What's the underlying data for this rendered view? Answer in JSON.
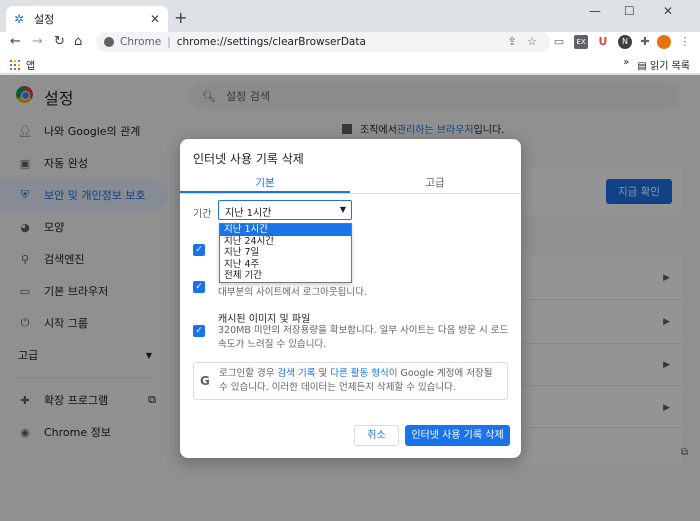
{
  "browser": {
    "tab_title": "설정",
    "tab_close": "✕",
    "new_tab": "+",
    "window_controls": [
      "—",
      "☐",
      "✕"
    ],
    "nav": {
      "back": "←",
      "forward": "→",
      "reload": "↻",
      "home": "⌂"
    },
    "url_host": "Chrome",
    "url_sep": "|",
    "url_path": "chrome://settings/clearBrowserData",
    "bookmarks": {
      "apps_label": "앱",
      "more": "»",
      "reading_list": "읽기 목록"
    },
    "colors": {
      "accent": "#1a73e8",
      "tabstrip": "#dee1e6"
    }
  },
  "settings": {
    "title": "설정",
    "search_placeholder": "설정 검색",
    "sidebar": [
      {
        "label": "나와 Google의 관계",
        "icon": "person-icon"
      },
      {
        "label": "자동 완성",
        "icon": "clipboard-icon"
      },
      {
        "label": "보안 및 개인정보 보호",
        "icon": "shield-icon",
        "active": true
      },
      {
        "label": "모양",
        "icon": "palette-icon"
      },
      {
        "label": "검색엔진",
        "icon": "search-icon"
      },
      {
        "label": "기본 브라우저",
        "icon": "browser-icon"
      },
      {
        "label": "시작 그룹",
        "icon": "power-icon"
      }
    ],
    "advanced": "고급",
    "extensions": "확장 프로그램",
    "about": "Chrome 정보",
    "managed_prefix": "조직에서 ",
    "managed_link": "관리하는 브라우저",
    "managed_suffix": "입니다.",
    "check_now": "지금 확인"
  },
  "dialog": {
    "title": "인터넷 사용 기록 삭제",
    "tabs": {
      "basic": "기본",
      "advanced": "고급"
    },
    "range_label": "기간",
    "range_selected": "지난 1시간",
    "range_options": [
      "지난 1시간",
      "지난 24시간",
      "지난 7일",
      "지난 4주",
      "전체 기간"
    ],
    "cookies_desc_partial": "대부분의 사이트에서 로그아웃됩니다.",
    "cache_title": "캐시된 이미지 및 파일",
    "cache_desc": "320MB 미만의 저장용량을 확보합니다. 일부 사이트는 다음 방문 시 로드 속도가 느려질 수 있습니다.",
    "info": {
      "part1": "로그인할 경우 ",
      "link1": "검색 기록",
      "part2": " 및 ",
      "link2": "다른 활동 형식",
      "part3": "이 Google 계정에 저장될 수 있습니다. 이러한 데이터는 언제든지 삭제할 수 있습니다."
    },
    "cancel": "취소",
    "confirm": "인터넷 사용 기록 삭제"
  }
}
